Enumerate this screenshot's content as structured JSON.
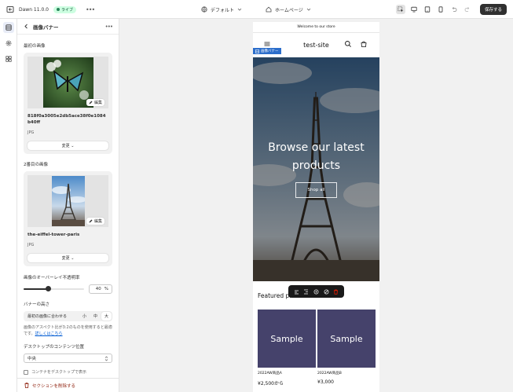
{
  "topbar": {
    "theme_name": "Dawn 11.0.0",
    "live_badge": "ライブ",
    "theme_select": "デフォルト",
    "page_select": "ホームページ",
    "save_label": "保存する"
  },
  "panel": {
    "title": "画像バナー",
    "first_image": {
      "label": "最初の画像",
      "edit_label": "編集",
      "filename": "818f0a3005e2db5ace38f0e1084b40ff",
      "filetype": "JPG",
      "change_label": "変更"
    },
    "second_image": {
      "label": "2番目の画像",
      "edit_label": "編集",
      "filename": "the-eiffel-tower-paris",
      "filetype": "JPG",
      "change_label": "変更"
    },
    "overlay": {
      "label": "画像のオーバーレイ不透明率",
      "value": "40",
      "unit": "%",
      "fraction": 0.4
    },
    "banner_height": {
      "label": "バナーの高さ",
      "options": [
        "最初の画像に合わせる",
        "小",
        "中",
        "大"
      ],
      "help_text": "画像のアスペクト比が3:2のものを使用すると最適です。",
      "help_link": "詳しくはこちら"
    },
    "desktop_position": {
      "label": "デスクトップのコンテンツ位置",
      "value": "中央"
    },
    "partial_label": "コンテナをデスクトップで表示",
    "remove_label": "セクションを削除する"
  },
  "preview": {
    "announcement": "Welcome to our store",
    "site_title": "test-site",
    "banner_tag": "画像バナー",
    "banner_heading": "Browse our latest products",
    "banner_button": "Shop all",
    "featured_title": "Featured products",
    "products": [
      {
        "image_text": "Sample",
        "name": "2022AW商品A",
        "price": "¥2,500から"
      },
      {
        "image_text": "Sample",
        "name": "2022AW商品B",
        "price": "¥3,000"
      }
    ]
  },
  "icons": {
    "exit": "exit-icon",
    "more": "more-icon",
    "theme": "globe-icon",
    "page": "home-icon",
    "inspect": "inspector-icon",
    "desktop": "desktop-icon",
    "tablet": "tablet-icon",
    "mobile": "mobile-icon",
    "undo": "undo-icon",
    "redo": "redo-icon"
  },
  "colors": {
    "accent": "#2c6ecb",
    "live_badge_bg": "#cdfee1",
    "save_bg": "#303030",
    "product_bg": "#45426b",
    "danger": "#8e1f0b"
  }
}
